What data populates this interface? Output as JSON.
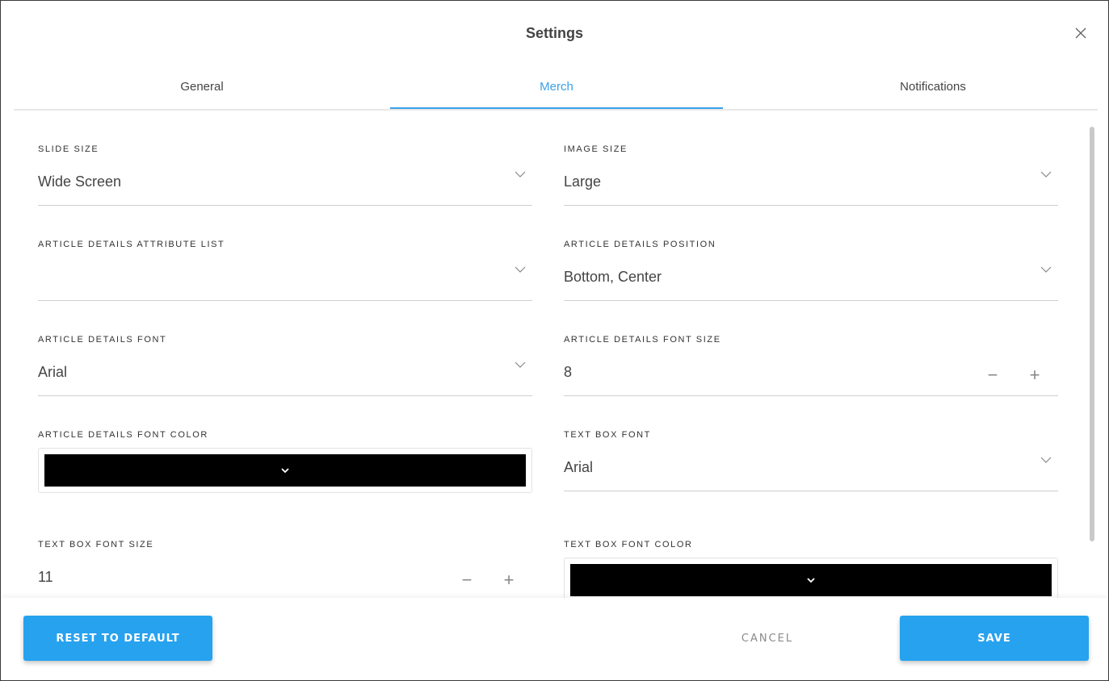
{
  "dialog": {
    "title": "Settings",
    "close_icon": "close-icon"
  },
  "tabs": [
    {
      "label": "General",
      "active": false
    },
    {
      "label": "Merch",
      "active": true
    },
    {
      "label": "Notifications",
      "active": false
    }
  ],
  "fields": {
    "slide_size": {
      "label": "SLIDE SIZE",
      "value": "Wide Screen"
    },
    "image_size": {
      "label": "IMAGE SIZE",
      "value": "Large"
    },
    "attr_list": {
      "label": "ARTICLE DETAILS ATTRIBUTE LIST",
      "value": ""
    },
    "details_position": {
      "label": "ARTICLE DETAILS POSITION",
      "value": "Bottom, Center"
    },
    "details_font": {
      "label": "ARTICLE DETAILS FONT",
      "value": "Arial"
    },
    "details_font_size": {
      "label": "ARTICLE DETAILS FONT SIZE",
      "value": "8"
    },
    "details_font_color": {
      "label": "ARTICLE DETAILS FONT COLOR",
      "color": "#000000"
    },
    "textbox_font": {
      "label": "TEXT BOX FONT",
      "value": "Arial"
    },
    "textbox_font_size": {
      "label": "TEXT BOX FONT SIZE",
      "value": "11"
    },
    "textbox_font_color": {
      "label": "TEXT BOX FONT COLOR",
      "color": "#000000"
    }
  },
  "stepper": {
    "minus": "−",
    "plus": "+"
  },
  "footer": {
    "reset_label": "RESET TO DEFAULT",
    "cancel_label": "CANCEL",
    "save_label": "SAVE"
  },
  "colors": {
    "accent": "#27a2ef",
    "tab_active": "#3aa0e8"
  }
}
